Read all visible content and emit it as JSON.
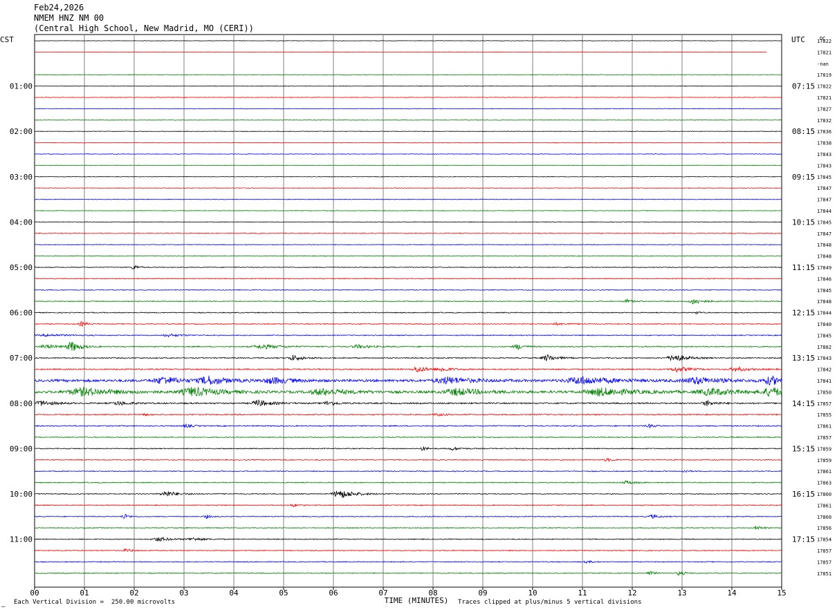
{
  "header": {
    "date": "Feb24,2026",
    "station": "NMEM HNZ NM 00",
    "site": "(Central High School, New Madrid, MO (CERI))"
  },
  "footer": {
    "scale_note": "Each Vertical Division =  250.00 microvolts",
    "clip_note": "Traces clipped at plus/minus 5 vertical divisions",
    "corner_mark": "͜"
  },
  "chart_data": {
    "type": "line",
    "subtype": "helicorder",
    "xlabel": "TIME (MINUTES)",
    "xlim": [
      0,
      15
    ],
    "x_ticks": [
      "00",
      "01",
      "02",
      "03",
      "04",
      "05",
      "06",
      "07",
      "08",
      "09",
      "10",
      "11",
      "12",
      "13",
      "14",
      "15"
    ],
    "left_axis_title": "CST",
    "right_axis_title": "UTC",
    "dc_title": "DC",
    "grid": true,
    "trace_colors": [
      "#000000",
      "#ff0000",
      "#0000ff",
      "#008000"
    ],
    "rows": [
      {
        "cst": "",
        "utc": "",
        "dc": "17822"
      },
      {
        "cst": "",
        "utc": "",
        "dc": "17821"
      },
      {
        "cst": "",
        "utc": "",
        "dc": "-nan"
      },
      {
        "cst": "",
        "utc": "",
        "dc": "17819"
      },
      {
        "cst": "01:00",
        "utc": "07:15",
        "dc": "17822"
      },
      {
        "cst": "",
        "utc": "",
        "dc": "17821"
      },
      {
        "cst": "",
        "utc": "",
        "dc": "17827"
      },
      {
        "cst": "",
        "utc": "",
        "dc": "17832"
      },
      {
        "cst": "02:00",
        "utc": "08:15",
        "dc": "17836"
      },
      {
        "cst": "",
        "utc": "",
        "dc": "17838"
      },
      {
        "cst": "",
        "utc": "",
        "dc": "17843"
      },
      {
        "cst": "",
        "utc": "",
        "dc": "17843"
      },
      {
        "cst": "03:00",
        "utc": "09:15",
        "dc": "17845"
      },
      {
        "cst": "",
        "utc": "",
        "dc": "17847"
      },
      {
        "cst": "",
        "utc": "",
        "dc": "17847"
      },
      {
        "cst": "",
        "utc": "",
        "dc": "17844"
      },
      {
        "cst": "04:00",
        "utc": "10:15",
        "dc": "17845"
      },
      {
        "cst": "",
        "utc": "",
        "dc": "17847"
      },
      {
        "cst": "",
        "utc": "",
        "dc": "17848"
      },
      {
        "cst": "",
        "utc": "",
        "dc": "17848"
      },
      {
        "cst": "05:00",
        "utc": "11:15",
        "dc": "17849"
      },
      {
        "cst": "",
        "utc": "",
        "dc": "17846"
      },
      {
        "cst": "",
        "utc": "",
        "dc": "17845"
      },
      {
        "cst": "",
        "utc": "",
        "dc": "17848"
      },
      {
        "cst": "06:00",
        "utc": "12:15",
        "dc": "17844"
      },
      {
        "cst": "",
        "utc": "",
        "dc": "17840"
      },
      {
        "cst": "",
        "utc": "",
        "dc": "17845"
      },
      {
        "cst": "",
        "utc": "",
        "dc": "17882"
      },
      {
        "cst": "07:00",
        "utc": "13:15",
        "dc": "17843"
      },
      {
        "cst": "",
        "utc": "",
        "dc": "17842"
      },
      {
        "cst": "",
        "utc": "",
        "dc": "17841"
      },
      {
        "cst": "",
        "utc": "",
        "dc": "17850"
      },
      {
        "cst": "08:00",
        "utc": "14:15",
        "dc": "17857"
      },
      {
        "cst": "",
        "utc": "",
        "dc": "17855"
      },
      {
        "cst": "",
        "utc": "",
        "dc": "17861"
      },
      {
        "cst": "",
        "utc": "",
        "dc": "17857"
      },
      {
        "cst": "09:00",
        "utc": "15:15",
        "dc": "17859"
      },
      {
        "cst": "",
        "utc": "",
        "dc": "17859"
      },
      {
        "cst": "",
        "utc": "",
        "dc": "17861"
      },
      {
        "cst": "",
        "utc": "",
        "dc": "17863"
      },
      {
        "cst": "10:00",
        "utc": "16:15",
        "dc": "17860"
      },
      {
        "cst": "",
        "utc": "",
        "dc": "17861"
      },
      {
        "cst": "",
        "utc": "",
        "dc": "17860"
      },
      {
        "cst": "",
        "utc": "",
        "dc": "17856"
      },
      {
        "cst": "11:00",
        "utc": "17:15",
        "dc": "17854"
      },
      {
        "cst": "",
        "utc": "",
        "dc": "17857"
      },
      {
        "cst": "",
        "utc": "",
        "dc": "17857"
      },
      {
        "cst": "",
        "utc": "",
        "dc": "17851"
      }
    ],
    "row_noise": [
      0.3,
      0.3,
      0,
      0.35,
      0.35,
      0.35,
      0.35,
      0.35,
      0.35,
      0.35,
      0.35,
      0.35,
      0.35,
      0.35,
      0.4,
      0.4,
      0.4,
      0.45,
      0.45,
      0.45,
      0.5,
      0.5,
      0.5,
      0.55,
      0.55,
      0.55,
      0.6,
      0.7,
      0.7,
      0.8,
      1.6,
      1.6,
      0.9,
      0.7,
      0.7,
      0.6,
      0.6,
      0.55,
      0.55,
      0.55,
      0.55,
      0.55,
      0.55,
      0.55,
      0.55,
      0.55,
      0.55,
      0.55
    ],
    "row_end": {
      "1": 14.7,
      "2": 0
    },
    "events": [
      {
        "row": 20,
        "t": 2.0,
        "amp": 7,
        "w": 0.08
      },
      {
        "row": 23,
        "t": 11.9,
        "amp": 5,
        "w": 0.1
      },
      {
        "row": 23,
        "t": 13.25,
        "amp": 9,
        "w": 0.15
      },
      {
        "row": 24,
        "t": 13.3,
        "amp": 4,
        "w": 0.05
      },
      {
        "row": 25,
        "t": 0.95,
        "amp": 6,
        "w": 0.1
      },
      {
        "row": 25,
        "t": 10.5,
        "amp": 3,
        "w": 0.2
      },
      {
        "row": 26,
        "t": 2.7,
        "amp": 4,
        "w": 0.2
      },
      {
        "row": 26,
        "t": 0.3,
        "amp": 3,
        "w": 0.3
      },
      {
        "row": 27,
        "t": 0.25,
        "amp": 5,
        "w": 0.25
      },
      {
        "row": 27,
        "t": 0.75,
        "amp": 14,
        "w": 0.15
      },
      {
        "row": 27,
        "t": 4.6,
        "amp": 6,
        "w": 0.3
      },
      {
        "row": 27,
        "t": 6.5,
        "amp": 5,
        "w": 0.2
      },
      {
        "row": 27,
        "t": 9.7,
        "amp": 8,
        "w": 0.12
      },
      {
        "row": 28,
        "t": 5.2,
        "amp": 8,
        "w": 0.15
      },
      {
        "row": 28,
        "t": 10.3,
        "amp": 9,
        "w": 0.15
      },
      {
        "row": 28,
        "t": 12.85,
        "amp": 11,
        "w": 0.2
      },
      {
        "row": 29,
        "t": 7.7,
        "amp": 9,
        "w": 0.15
      },
      {
        "row": 29,
        "t": 8.2,
        "amp": 6,
        "w": 0.15
      },
      {
        "row": 29,
        "t": 12.9,
        "amp": 7,
        "w": 0.2
      },
      {
        "row": 29,
        "t": 14.1,
        "amp": 6,
        "w": 0.2
      },
      {
        "row": 30,
        "t": 2.6,
        "amp": 10,
        "w": 0.3
      },
      {
        "row": 30,
        "t": 3.5,
        "amp": 11,
        "w": 0.3
      },
      {
        "row": 30,
        "t": 4.8,
        "amp": 8,
        "w": 0.3
      },
      {
        "row": 30,
        "t": 8.3,
        "amp": 9,
        "w": 0.4
      },
      {
        "row": 30,
        "t": 11.0,
        "amp": 10,
        "w": 0.5
      },
      {
        "row": 30,
        "t": 13.3,
        "amp": 9,
        "w": 0.4
      },
      {
        "row": 30,
        "t": 14.8,
        "amp": 10,
        "w": 0.3
      },
      {
        "row": 31,
        "t": 1.0,
        "amp": 10,
        "w": 0.5
      },
      {
        "row": 31,
        "t": 3.2,
        "amp": 12,
        "w": 0.4
      },
      {
        "row": 31,
        "t": 5.8,
        "amp": 8,
        "w": 0.4
      },
      {
        "row": 31,
        "t": 8.5,
        "amp": 9,
        "w": 0.4
      },
      {
        "row": 31,
        "t": 11.4,
        "amp": 10,
        "w": 0.5
      },
      {
        "row": 31,
        "t": 13.6,
        "amp": 9,
        "w": 0.4
      },
      {
        "row": 31,
        "t": 14.8,
        "amp": 11,
        "w": 0.3
      },
      {
        "row": 32,
        "t": 0.15,
        "amp": 7,
        "w": 0.2
      },
      {
        "row": 32,
        "t": 1.7,
        "amp": 5,
        "w": 0.2
      },
      {
        "row": 32,
        "t": 4.5,
        "amp": 9,
        "w": 0.2
      },
      {
        "row": 32,
        "t": 5.9,
        "amp": 6,
        "w": 0.15
      },
      {
        "row": 32,
        "t": 13.5,
        "amp": 7,
        "w": 0.15
      },
      {
        "row": 33,
        "t": 2.2,
        "amp": 3,
        "w": 0.1
      },
      {
        "row": 33,
        "t": 8.1,
        "amp": 3,
        "w": 0.15
      },
      {
        "row": 34,
        "t": 3.05,
        "amp": 5,
        "w": 0.1
      },
      {
        "row": 34,
        "t": 12.35,
        "amp": 5,
        "w": 0.1
      },
      {
        "row": 36,
        "t": 7.8,
        "amp": 6,
        "w": 0.08
      },
      {
        "row": 36,
        "t": 8.4,
        "amp": 4,
        "w": 0.15
      },
      {
        "row": 37,
        "t": 11.5,
        "amp": 4,
        "w": 0.1
      },
      {
        "row": 38,
        "t": 13.05,
        "amp": 4,
        "w": 0.08
      },
      {
        "row": 39,
        "t": 11.9,
        "amp": 5,
        "w": 0.15
      },
      {
        "row": 40,
        "t": 2.65,
        "amp": 8,
        "w": 0.2
      },
      {
        "row": 40,
        "t": 6.15,
        "amp": 12,
        "w": 0.25
      },
      {
        "row": 41,
        "t": 5.2,
        "amp": 4,
        "w": 0.1
      },
      {
        "row": 42,
        "t": 1.8,
        "amp": 8,
        "w": 0.08
      },
      {
        "row": 42,
        "t": 3.45,
        "amp": 5,
        "w": 0.08
      },
      {
        "row": 42,
        "t": 12.4,
        "amp": 5,
        "w": 0.12
      },
      {
        "row": 43,
        "t": 14.5,
        "amp": 5,
        "w": 0.1
      },
      {
        "row": 44,
        "t": 2.5,
        "amp": 6,
        "w": 0.2
      },
      {
        "row": 44,
        "t": 3.2,
        "amp": 4,
        "w": 0.2
      },
      {
        "row": 45,
        "t": 1.85,
        "amp": 5,
        "w": 0.1
      },
      {
        "row": 46,
        "t": 11.1,
        "amp": 3,
        "w": 0.1
      },
      {
        "row": 47,
        "t": 12.35,
        "amp": 7,
        "w": 0.08
      },
      {
        "row": 47,
        "t": 12.95,
        "amp": 6,
        "w": 0.1
      }
    ]
  }
}
